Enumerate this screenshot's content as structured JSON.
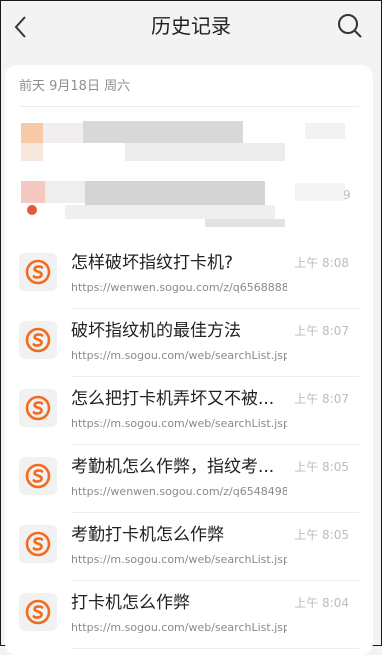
{
  "header": {
    "title": "历史记录",
    "back_icon": "chevron-left-icon",
    "search_icon": "search-icon"
  },
  "section": {
    "date": "前天 9月18日 周六"
  },
  "colors": {
    "sogou_orange": "#f26b1f",
    "icon_bg": "#f1f1f1"
  },
  "partial_time": "9",
  "items": [
    {
      "title": "怎样破坏指纹打卡机?",
      "url": "https://wenwen.sogou.com/z/q65688880...",
      "time": "上午 8:08"
    },
    {
      "title": "破坏指纹机的最佳方法",
      "url": "https://m.sogou.com/web/searchList.jsp?...",
      "time": "上午 8:07"
    },
    {
      "title": "怎么把打卡机弄坏又不被...",
      "url": "https://m.sogou.com/web/searchList.jsp?...",
      "time": "上午 8:07"
    },
    {
      "title": "考勤机怎么作弊，指纹考...",
      "url": "https://wenwen.sogou.com/z/q65484986...",
      "time": "上午 8:05"
    },
    {
      "title": "考勤打卡机怎么作弊",
      "url": "https://m.sogou.com/web/searchList.jsp?...",
      "time": "上午 8:05"
    },
    {
      "title": "打卡机怎么作弊",
      "url": "https://m.sogou.com/web/searchList.jsp?...",
      "time": "上午 8:04"
    }
  ]
}
